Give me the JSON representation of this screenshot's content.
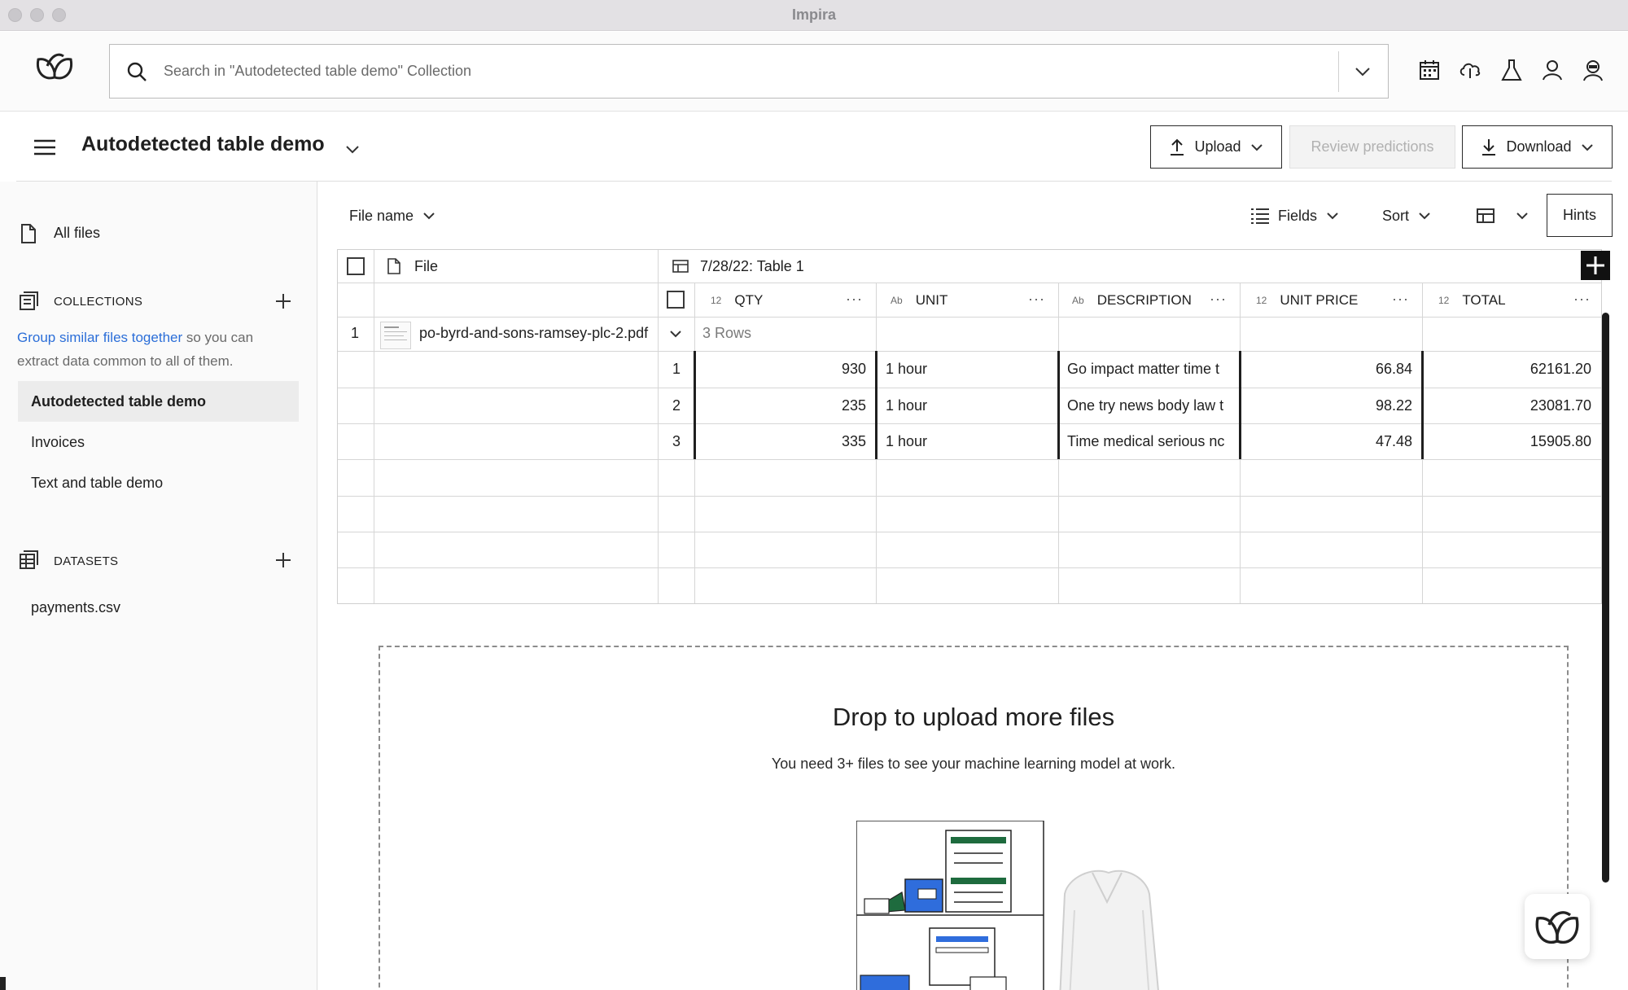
{
  "window": {
    "title": "Impira"
  },
  "search": {
    "placeholder": "Search in \"Autodetected table demo\" Collection"
  },
  "toolbar_icons": [
    "calendar-icon",
    "cloud-icon",
    "flask-icon",
    "user-icon",
    "bot-icon"
  ],
  "header": {
    "collection_title": "Autodetected table demo",
    "upload_label": "Upload",
    "review_label": "Review predictions",
    "download_label": "Download"
  },
  "sidebar": {
    "all_files": "All files",
    "collections_label": "COLLECTIONS",
    "help_link": "Group similar files together",
    "help_text_1": " so you can",
    "help_text_2": "extract data common to all of them.",
    "collections": [
      {
        "label": "Autodetected table demo",
        "active": true
      },
      {
        "label": "Invoices",
        "active": false
      },
      {
        "label": "Text and table demo",
        "active": false
      }
    ],
    "datasets_label": "DATASETS",
    "datasets": [
      {
        "label": "payments.csv"
      }
    ]
  },
  "main_toolbar": {
    "file_name_label": "File name",
    "fields_label": "Fields",
    "sort_label": "Sort",
    "hints_label": "Hints"
  },
  "table": {
    "file_header": "File",
    "group_header": "7/28/22: Table 1",
    "columns": [
      {
        "tag": "12",
        "name": "QTY"
      },
      {
        "tag": "Ab",
        "name": "UNIT"
      },
      {
        "tag": "Ab",
        "name": "DESCRIPTION"
      },
      {
        "tag": "12",
        "name": "UNIT PRICE"
      },
      {
        "tag": "12",
        "name": "TOTAL"
      }
    ],
    "file_row": {
      "index": "1",
      "file_name": "po-byrd-and-sons-ramsey-plc-2.pdf",
      "rows_summary": "3 Rows"
    },
    "rows": [
      {
        "n": "1",
        "qty": "930",
        "unit": "1 hour",
        "description": "Go impact matter time t",
        "unit_price": "66.84",
        "total": "62161.20"
      },
      {
        "n": "2",
        "qty": "235",
        "unit": "1 hour",
        "description": "One try news body law t",
        "unit_price": "98.22",
        "total": "23081.70"
      },
      {
        "n": "3",
        "qty": "335",
        "unit": "1 hour",
        "description": "Time medical serious nc",
        "unit_price": "47.48",
        "total": "15905.80"
      }
    ]
  },
  "dropzone": {
    "title": "Drop to upload more files",
    "subtitle": "You need 3+ files to see your machine learning model at work."
  },
  "colors": {
    "accent_link": "#2b6ed8",
    "illustration_green": "#1e6b3e",
    "illustration_blue": "#2f6ddc"
  }
}
